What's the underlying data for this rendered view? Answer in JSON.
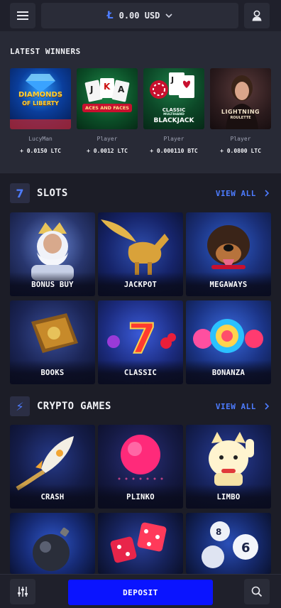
{
  "header": {
    "currency_symbol": "Ł",
    "balance": "0.00 USD",
    "menu_icon": "hamburger-menu-icon",
    "user_icon": "user-icon",
    "caret_icon": "chevron-down-icon"
  },
  "winners": {
    "title": "LATEST WINNERS",
    "items": [
      {
        "player": "LucyMan",
        "amount": "+ 0.0150 LTC",
        "game_art_text": [
          "DIAMONDS",
          "OF LIBERTY"
        ]
      },
      {
        "player": "Player",
        "amount": "+ 0.0012 LTC",
        "game_art_text": [
          "ACES AND FACES"
        ]
      },
      {
        "player": "Player",
        "amount": "+ 0.000110 BTC",
        "game_art_text": [
          "CLASSIC",
          "MULTIHAND",
          "BLACKJACK"
        ]
      },
      {
        "player": "Player",
        "amount": "+ 0.0800 LTC",
        "game_art_text": [
          "LIGHTNING",
          "ROULETTE"
        ]
      }
    ]
  },
  "slots": {
    "title": "SLOTS",
    "icon_glyph": "7",
    "view_all": "VIEW ALL",
    "tiles": [
      {
        "label": "BONUS BUY"
      },
      {
        "label": "JACKPOT"
      },
      {
        "label": "MEGAWAYS"
      },
      {
        "label": "BOOKS"
      },
      {
        "label": "CLASSIC"
      },
      {
        "label": "BONANZA"
      }
    ]
  },
  "crypto": {
    "title": "CRYPTO GAMES",
    "icon_glyph": "⚡",
    "view_all": "VIEW ALL",
    "tiles": [
      {
        "label": "CRASH"
      },
      {
        "label": "PLINKO"
      },
      {
        "label": "LIMBO"
      },
      {
        "label": ""
      },
      {
        "label": ""
      },
      {
        "label": ""
      }
    ]
  },
  "footer": {
    "deposit_label": "DEPOSIT",
    "filter_icon": "sliders-icon",
    "search_icon": "search-icon"
  },
  "colors": {
    "background": "#1c1d27",
    "panel": "#282a36",
    "accent": "#4d7cff",
    "deposit": "#0a14ff"
  }
}
